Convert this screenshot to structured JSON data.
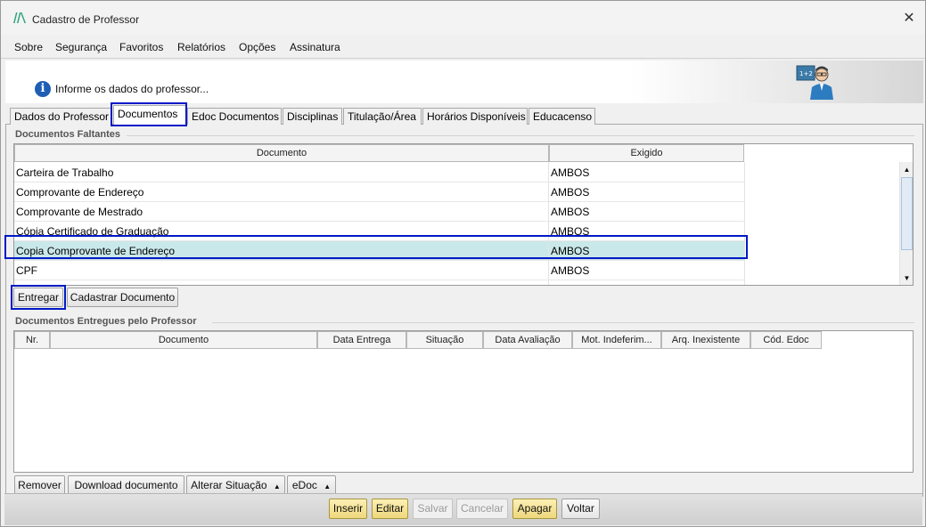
{
  "window": {
    "title": "Cadastro de Professor",
    "close_glyph": "✕"
  },
  "menu": [
    {
      "label": "Sobre"
    },
    {
      "label": "Segurança"
    },
    {
      "label": "Favoritos"
    },
    {
      "label": "Relatórios"
    },
    {
      "label": "Opções"
    },
    {
      "label": "Assinatura"
    }
  ],
  "header": {
    "info_text": "Informe os dados do professor...",
    "info_icon": "info-icon",
    "illustration": "teacher-icon"
  },
  "tabs": [
    {
      "label": "Dados do Professor",
      "active": false
    },
    {
      "label": "Documentos",
      "active": true
    },
    {
      "label": "Edoc Documentos",
      "active": false
    },
    {
      "label": "Disciplinas",
      "active": false
    },
    {
      "label": "Titulação/Área",
      "active": false
    },
    {
      "label": "Horários Disponíveis",
      "active": false
    },
    {
      "label": "Educacenso",
      "active": false
    }
  ],
  "faltantes": {
    "group_title": "Documentos Faltantes",
    "columns": [
      "Documento",
      "Exigido"
    ],
    "rows": [
      {
        "documento": "Carteira de Trabalho",
        "exigido": "AMBOS",
        "selected": false
      },
      {
        "documento": "Comprovante de Endereço",
        "exigido": "AMBOS",
        "selected": false
      },
      {
        "documento": "Comprovante de Mestrado",
        "exigido": "AMBOS",
        "selected": false
      },
      {
        "documento": "Cópia Certificado de Graduação",
        "exigido": "AMBOS",
        "selected": false
      },
      {
        "documento": "Copia Comprovante de Endereço",
        "exigido": "AMBOS",
        "selected": true
      },
      {
        "documento": "CPF",
        "exigido": "AMBOS",
        "selected": false
      }
    ],
    "buttons": {
      "entregar": "Entregar",
      "cadastrar": "Cadastrar Documento"
    }
  },
  "entregues": {
    "group_title": "Documentos Entregues pelo Professor",
    "columns": [
      "Nr.",
      "Documento",
      "Data Entrega",
      "Situação",
      "Data Avaliação",
      "Mot. Indeferim...",
      "Arq. Inexistente",
      "Cód. Edoc"
    ],
    "buttons": {
      "remover": "Remover",
      "download": "Download documento",
      "alterar": "Alterar Situação",
      "edoc": "eDoc"
    }
  },
  "actions": [
    {
      "label": "Inserir",
      "state": "enabled"
    },
    {
      "label": "Editar",
      "state": "enabled"
    },
    {
      "label": "Salvar",
      "state": "disabled"
    },
    {
      "label": "Cancelar",
      "state": "disabled"
    },
    {
      "label": "Apagar",
      "state": "enabled"
    },
    {
      "label": "Voltar",
      "state": "enabled"
    }
  ],
  "colors": {
    "highlight_border": "#0019c7",
    "selected_row": "#c9e8e9",
    "action_yellow": "#eed77c"
  }
}
